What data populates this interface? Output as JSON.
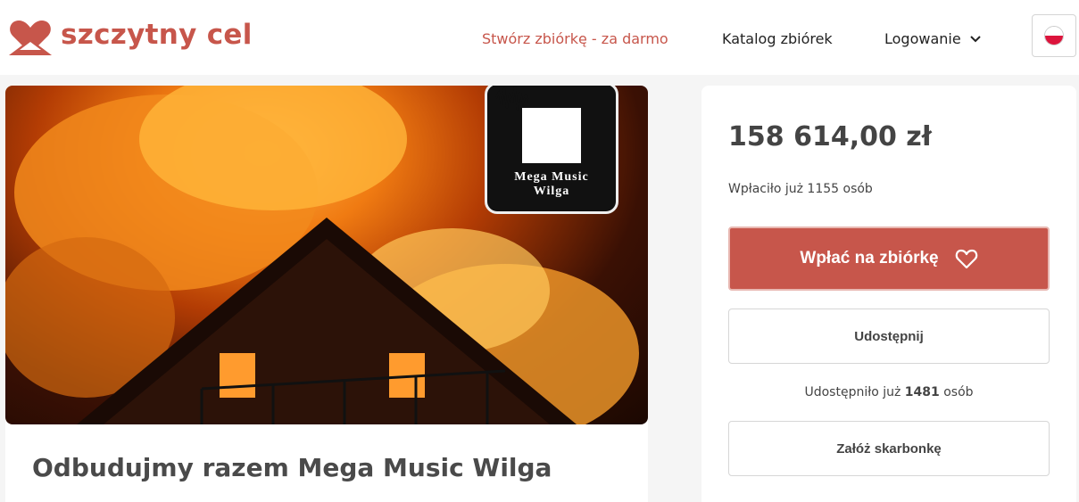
{
  "header": {
    "logo_text": "szczytny cel",
    "nav": {
      "create": "Stwórz zbiórkę - za darmo",
      "catalog": "Katalog zbiórek",
      "login": "Logowanie"
    },
    "language": "PL"
  },
  "campaign": {
    "title": "Odbudujmy razem Mega Music Wilga",
    "image_logo_text_line1": "Mega Music",
    "image_logo_text_line2": "Wilga"
  },
  "sidebar": {
    "amount": "158 614,00 zł",
    "donors_text": "Wpłaciło już 1155 osób",
    "donate_button": "Wpłać na zbiórkę",
    "share_button": "Udostępnij",
    "shares_prefix": "Udostępniło już",
    "shares_count": "1481",
    "shares_suffix": "osób",
    "piggy_button": "Załóż skarbonkę"
  },
  "colors": {
    "brand": "#c7564b",
    "text": "#444444",
    "background": "#f5f5f5"
  },
  "icons": [
    "logo-heart-icon",
    "chevron-down-icon",
    "poland-flag-icon",
    "heart-outline-icon",
    "waveform-icon"
  ]
}
